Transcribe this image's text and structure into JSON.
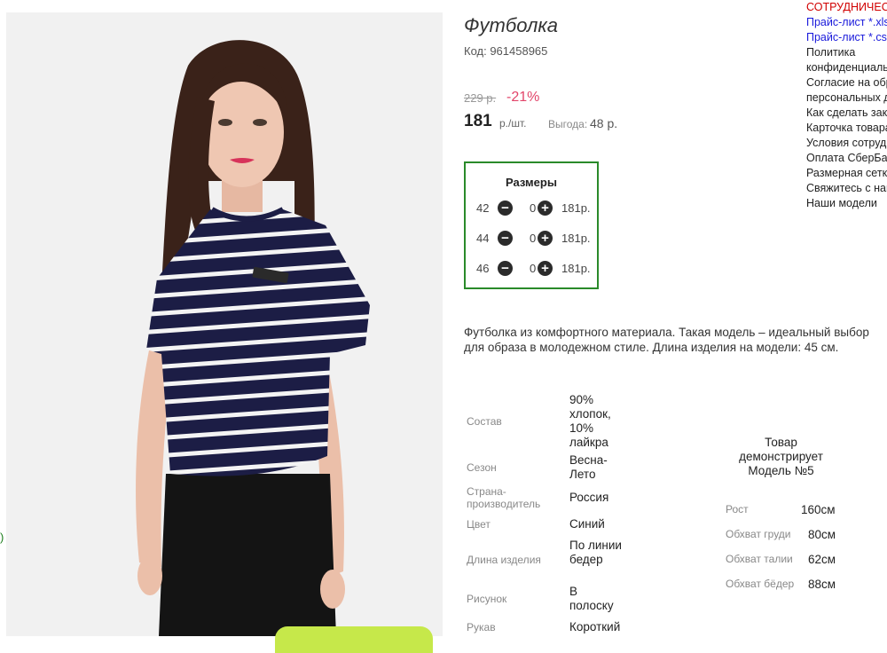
{
  "product": {
    "title": "Футболка",
    "code": "Код: 961458965",
    "old_price": "229 р.",
    "discount": "-21%",
    "price": "181",
    "unit": "р./шт.",
    "benefit_label": "Выгода:",
    "benefit_value": "48 р."
  },
  "sizes": {
    "title": "Размеры",
    "rows": [
      {
        "size": "42",
        "qty": "0",
        "price": "181р."
      },
      {
        "size": "44",
        "qty": "0",
        "price": "181р."
      },
      {
        "size": "46",
        "qty": "0",
        "price": "181р."
      }
    ]
  },
  "description": "Футболка из комфортного материала. Такая модель – идеальный выбор для образа в молодежном стиле. Длина изделия на модели: 45 см.",
  "attributes": [
    {
      "label": "Состав",
      "value": "90% хлопок, 10% лайкра"
    },
    {
      "label": "Сезон",
      "value": "Весна-Лето"
    },
    {
      "label": "Страна-производитель",
      "value": "Россия"
    },
    {
      "label": "Цвет",
      "value": "Синий"
    },
    {
      "label": "Длина изделия",
      "value": "По линии бедер"
    },
    {
      "label": "Рисунок",
      "value": "В полоску"
    },
    {
      "label": "Рукав",
      "value": "Короткий"
    }
  ],
  "model": {
    "title": "Товар демонстрирует Модель №5",
    "measurements": [
      {
        "label": "Рост",
        "value": "160см"
      },
      {
        "label": "Обхват груди",
        "value": "80см"
      },
      {
        "label": "Обхват талии",
        "value": "62см"
      },
      {
        "label": "Обхват бёдер",
        "value": "88см"
      }
    ]
  },
  "side_links": [
    {
      "text": "СОТРУДНИЧЕСТВО",
      "style": "red"
    },
    {
      "text": "Прайс-лист *.xls",
      "style": "blue"
    },
    {
      "text": "Прайс-лист *.csv",
      "style": "blue"
    },
    {
      "text": "Политика",
      "style": "plain"
    },
    {
      "text": "конфиденциальности",
      "style": "plain"
    },
    {
      "text": "Согласие на обработку",
      "style": "plain"
    },
    {
      "text": "персональных данных",
      "style": "plain"
    },
    {
      "text": "Как сделать заказ",
      "style": "plain"
    },
    {
      "text": "Карточка товара",
      "style": "plain"
    },
    {
      "text": "Условия сотрудничества",
      "style": "plain"
    },
    {
      "text": "Оплата СберБанк",
      "style": "plain"
    },
    {
      "text": "Размерная сетка",
      "style": "plain"
    },
    {
      "text": "Свяжитесь с нами",
      "style": "plain"
    },
    {
      "text": "Наши модели",
      "style": "plain"
    }
  ],
  "left_mark": ")",
  "colors": {
    "accent_green": "#2a8a2a",
    "discount": "#e2456a",
    "link_blue": "#1a1adb",
    "link_red": "#d10000",
    "button_green": "#c6e84a"
  },
  "icons": {
    "minus": "minus-circle-icon",
    "plus": "plus-circle-icon"
  }
}
